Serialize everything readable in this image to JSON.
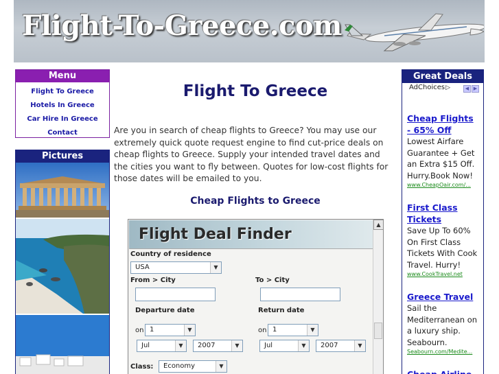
{
  "site": {
    "banner_title": "Flight-To-Greece.com"
  },
  "menu": {
    "header": "Menu",
    "items": [
      {
        "label": "Flight To Greece"
      },
      {
        "label": "Hotels In Greece"
      },
      {
        "label": "Car Hire In Greece"
      },
      {
        "label": "Contact"
      }
    ]
  },
  "pictures": {
    "header": "Pictures"
  },
  "main": {
    "title": "Flight To Greece",
    "intro": "Are you in search of cheap flights to Greece? You may use our extremely quick quote request engine to find cut-price deals on cheap flights to Greece. Supply your intended travel dates and the cities you want to fly between. Quotes for low-cost flights for those dates will be emailed to you.",
    "section_title": "Cheap Flights to Greece"
  },
  "finder": {
    "title": "Flight Deal Finder",
    "country_label": "Country of residence",
    "country_value": "USA",
    "from_label": "From > City",
    "to_label": "To > City",
    "departure_label": "Departure date",
    "return_label": "Return date",
    "on_label": "on",
    "dep_day": "1",
    "dep_month": "Jul",
    "dep_year": "2007",
    "ret_day": "1",
    "ret_month": "Jul",
    "ret_year": "2007",
    "class_label": "Class:",
    "class_value": "Economy"
  },
  "deals": {
    "header": "Great Deals",
    "adchoices": "AdChoices",
    "items": [
      {
        "title": "Cheap Flights - 65% Off",
        "desc": "Lowest Airfare Guarantee + Get an Extra $15 Off. Hurry.Book Now!",
        "url": "www.CheapOair.com/..."
      },
      {
        "title": "First Class Tickets",
        "desc": "Save Up To 60% On First Class Tickets With Cook Travel. Hurry!",
        "url": "www.CookTravel.net"
      },
      {
        "title": "Greece Travel",
        "desc": "Sail the Mediterranean on a luxury ship. Seabourn.",
        "url": "Seabourn.com/Medite..."
      },
      {
        "title": "Cheap Airline",
        "desc": "",
        "url": ""
      }
    ]
  }
}
